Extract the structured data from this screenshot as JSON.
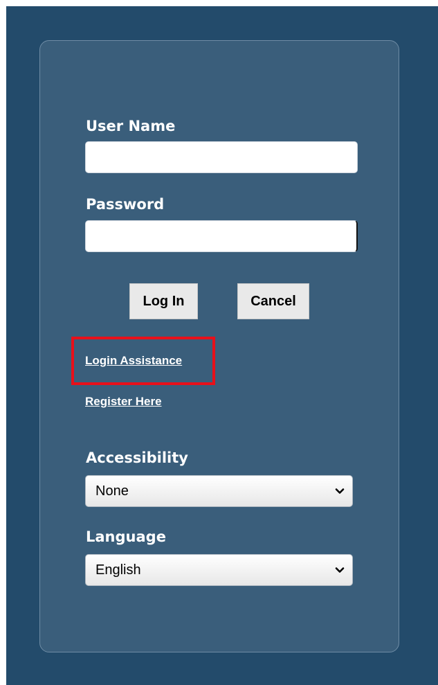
{
  "form": {
    "username_label": "User Name",
    "username_value": "",
    "password_label": "Password",
    "password_value": "",
    "login_button": "Log In",
    "cancel_button": "Cancel"
  },
  "links": {
    "login_assistance": "Login Assistance",
    "register": "Register Here"
  },
  "accessibility": {
    "label": "Accessibility",
    "selected": "None"
  },
  "language": {
    "label": "Language",
    "selected": "English"
  },
  "colors": {
    "background": "#234b6b",
    "panel": "#3a5e7b",
    "highlight": "#e8101a"
  },
  "icons": {
    "dropdown": "chevron-down-icon"
  }
}
